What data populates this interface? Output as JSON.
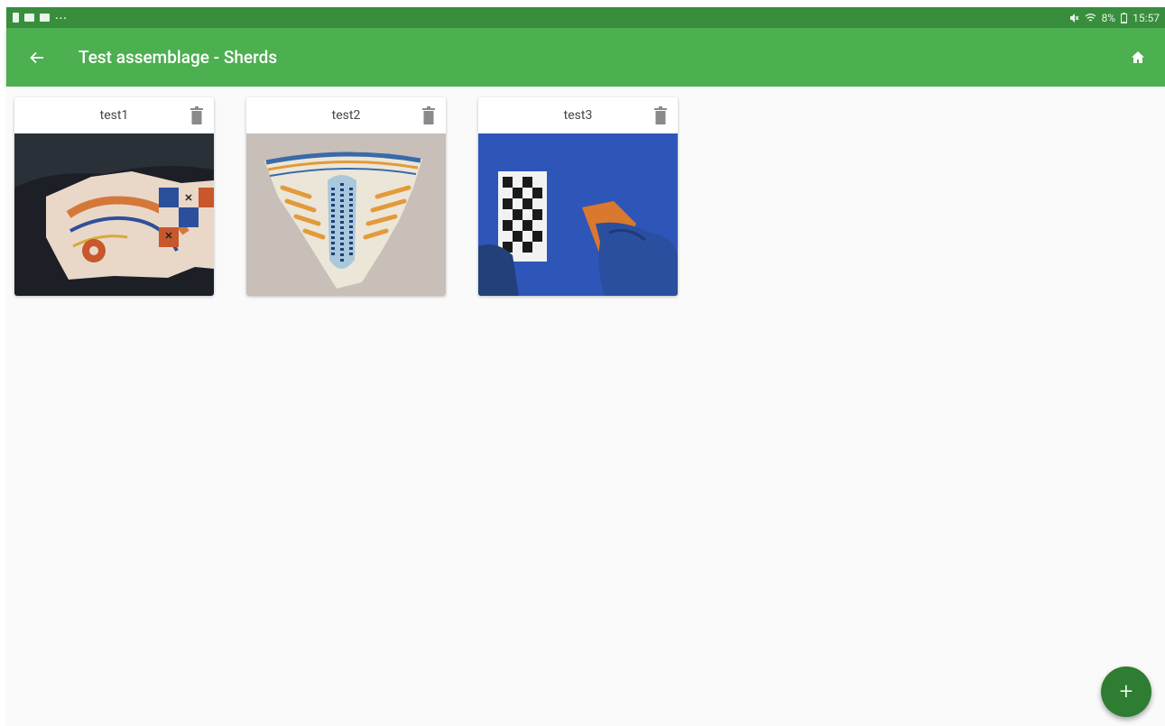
{
  "statusbar": {
    "time": "15:57",
    "battery": "8%",
    "left_icons": [
      "sim-icon",
      "gallery-icon",
      "message-icon",
      "more-notifications-icon"
    ],
    "right_icons": [
      "mute-icon",
      "wifi-icon",
      "battery-icon"
    ],
    "more_glyph": "···"
  },
  "appbar": {
    "title": "Test assemblage - Sherds",
    "back_icon": "arrow-back-icon",
    "home_icon": "home-icon",
    "color": "#4caf50"
  },
  "sherds": [
    {
      "name": "test1",
      "image": "decorated-ceramic-sherd-photo"
    },
    {
      "name": "test2",
      "image": "glazed-bowl-fragment-photo"
    },
    {
      "name": "test3",
      "image": "sherd-with-checkerboard-scale-photo"
    }
  ],
  "fab": {
    "glyph": "+",
    "icon": "add-icon",
    "color": "#2e7d32"
  }
}
